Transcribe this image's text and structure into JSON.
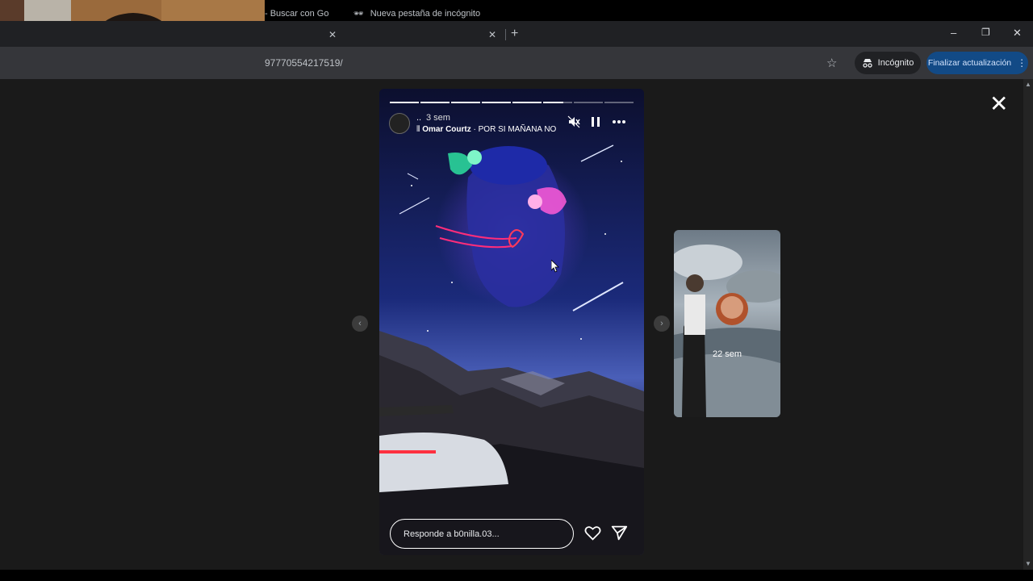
{
  "browser": {
    "tabs": [
      {
        "label": "- Buscar con Go"
      },
      {
        "label": "Nueva pestaña de incógnito"
      }
    ],
    "new_tab_icon": "plus-icon",
    "window_controls": {
      "minimize": "–",
      "restore": "❐",
      "close": "✕"
    },
    "url": "97770554217519/",
    "incognito_label": "Incógnito",
    "update_label": "Finalizar actualización"
  },
  "story": {
    "username": "..",
    "time": "3 sem",
    "music_artist": "Omar Courtz",
    "music_separator": " · ",
    "music_track": "POR SI MAÑANA NO",
    "progress_segments": 8,
    "progress_done": 5,
    "progress_partial": 0.7,
    "reply_placeholder": "Responde a b0nilla.03...",
    "icons": {
      "mute": "speaker-muted-icon",
      "pause": "pause-icon",
      "more": "more-icon",
      "like": "heart-icon",
      "share": "send-icon",
      "close": "close-icon"
    }
  },
  "next_story": {
    "time": "22 sem"
  },
  "colors": {
    "update_button": "#124a86",
    "viewport_bg": "#1a1a1a"
  }
}
